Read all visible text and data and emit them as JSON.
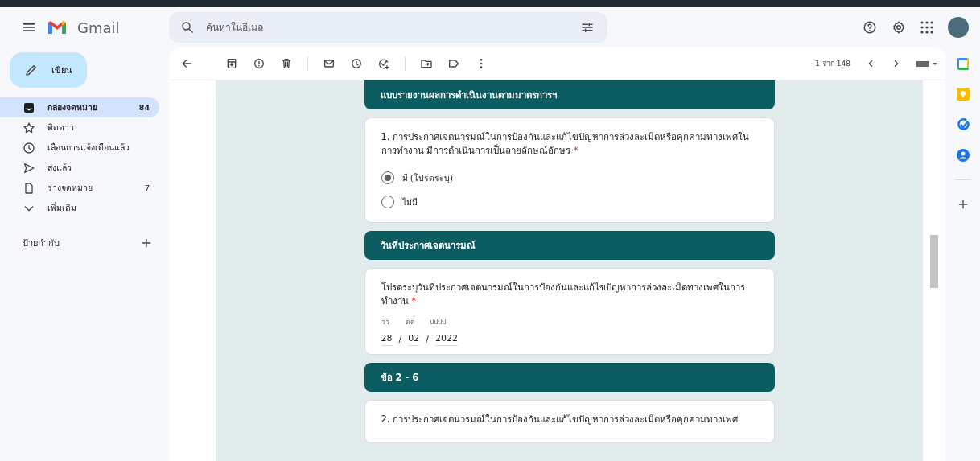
{
  "header": {
    "app_name": "Gmail",
    "search": {
      "placeholder": "ค้นหาในอีเมล"
    }
  },
  "compose": {
    "label": "เขียน"
  },
  "nav": [
    {
      "label": "กล่องจดหมาย",
      "count": "84",
      "selected": true
    },
    {
      "label": "ติดดาว",
      "selected": false
    },
    {
      "label": "เลื่อนการแจ้งเตือนแล้ว",
      "selected": false
    },
    {
      "label": "ส่งแล้ว",
      "selected": false
    },
    {
      "label": "ร่างจดหมาย",
      "count": "7",
      "selected": false
    },
    {
      "label": "เพิ่มเติม",
      "selected": false
    }
  ],
  "labels": {
    "heading": "ป้ายกำกับ"
  },
  "toolbar": {
    "pager": "1 จาก 148"
  },
  "form": [
    {
      "kind": "header",
      "title": "แบบรายงานผลการดำเนินงานตามมาตรการฯ"
    },
    {
      "kind": "radio",
      "question": "1. การประกาศเจตนารมณ์ในการป้องกันและแก้ไขปัญหาการล่วงละเมิดหรือคุกคามทางเพศในการทำงาน มีการดำเนินการเป็นลายลักษณ์อักษร",
      "required_mark": "*",
      "options": [
        {
          "label": "มี (โปรดระบุ)",
          "selected": true
        },
        {
          "label": "ไม่มี",
          "selected": false
        }
      ]
    },
    {
      "kind": "header",
      "title": "วันที่ประกาศเจตนารมณ์"
    },
    {
      "kind": "date",
      "question": "โปรดระบุวันที่ประกาศเจตนารมณ์ในการป้องกันและแก้ไขปัญหาการล่วงละเมิดทางเพศในการทำงาน",
      "required_mark": "*",
      "separator": "/",
      "parts": [
        {
          "label": "วว",
          "value": "28"
        },
        {
          "label": "ดด",
          "value": "02"
        },
        {
          "label": "ปปปป",
          "value": "2022"
        }
      ]
    },
    {
      "kind": "header",
      "title": "ข้อ 2 - 6"
    },
    {
      "kind": "text",
      "question": "2. การประกาศเจตนารมณ์ในการป้องกันและแก้ไขปัญหาการล่วงละเมิดหรือคุกคามทางเพศ"
    }
  ]
}
